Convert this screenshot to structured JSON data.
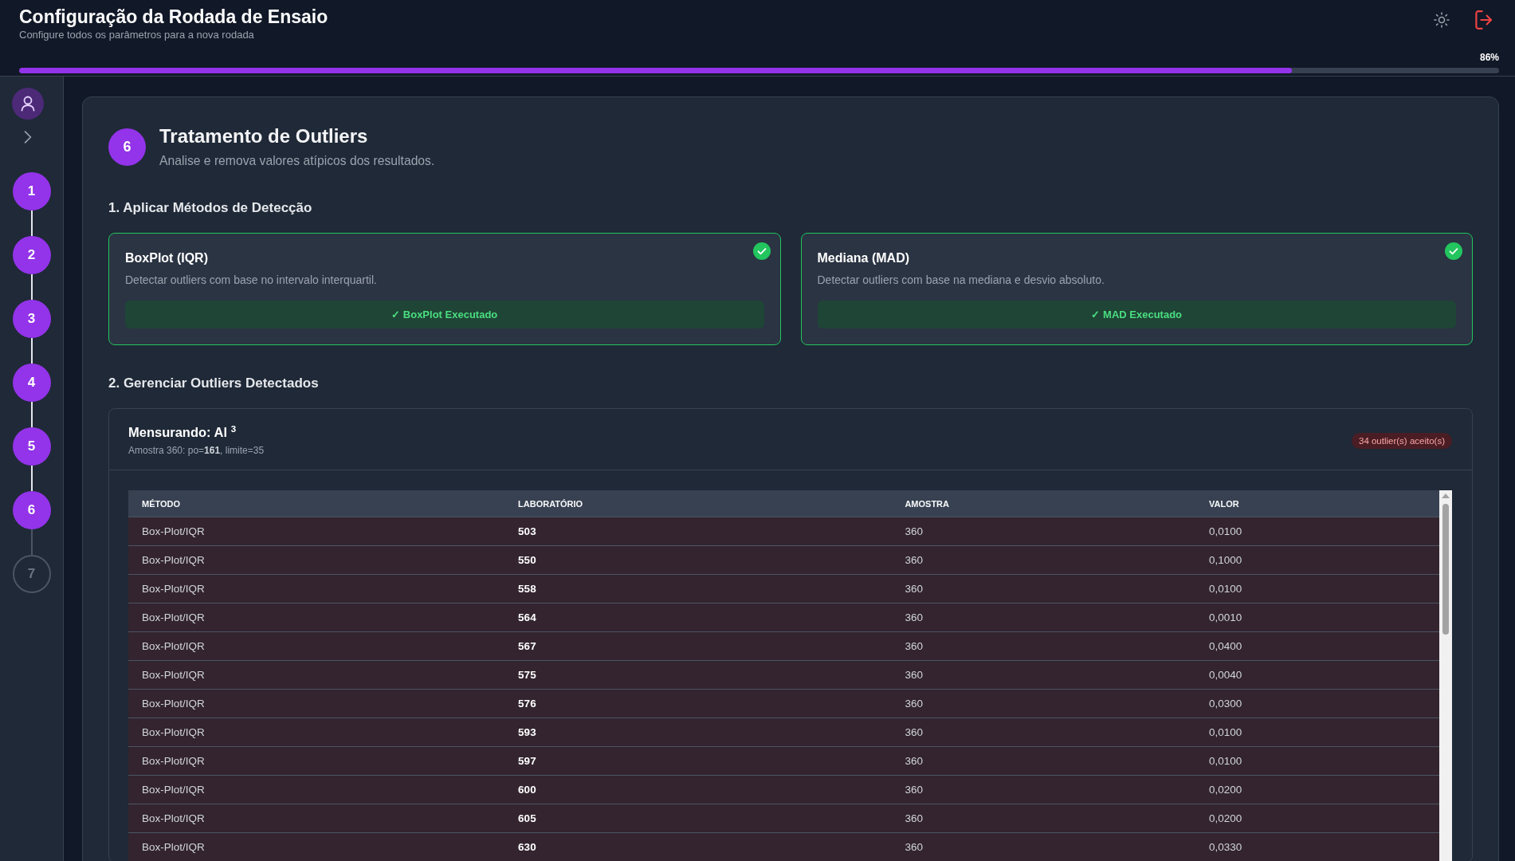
{
  "header": {
    "title": "Configuração da Rodada de Ensaio",
    "subtitle": "Configure todos os parâmetros para a nova rodada",
    "progress": {
      "level": 0.86,
      "reading": "86%"
    }
  },
  "sidebar": {
    "steps": [
      {
        "label": "1",
        "completed": true
      },
      {
        "label": "2",
        "completed": true
      },
      {
        "label": "3",
        "completed": true
      },
      {
        "label": "4",
        "completed": true
      },
      {
        "label": "5",
        "completed": true
      },
      {
        "label": "6",
        "completed": true
      },
      {
        "label": "7",
        "completed": false
      }
    ]
  },
  "step": {
    "number": "6",
    "title": "Tratamento de Outliers",
    "subtitle": "Analise e remova valores atípicos dos resultados."
  },
  "detection": {
    "heading": "1. Aplicar Métodos de Detecção",
    "methods": [
      {
        "title": "BoxPlot (IQR)",
        "description": "Detectar outliers com base no intervalo interquartil.",
        "action": "✓ BoxPlot Executado",
        "executed": true
      },
      {
        "title": "Mediana (MAD)",
        "description": "Detectar outliers com base na mediana e desvio absoluto.",
        "action": "✓ MAD Executado",
        "executed": true
      }
    ]
  },
  "outliers": {
    "heading": "2. Gerenciar Outliers Detectados",
    "measurand": "Mensurando: Al $^{3}$",
    "sample_info": "Amostra 360: po=**161**, limite=35",
    "badge": "34 outlier(s) aceito(s)",
    "table": {
      "columns": [
        "MÉTODO",
        "LABORATÓRIO",
        "AMOSTRA",
        "VALOR"
      ],
      "rows": [
        [
          "Box-Plot/IQR",
          "503",
          "360",
          "0,0100"
        ],
        [
          "Box-Plot/IQR",
          "550",
          "360",
          "0,1000"
        ],
        [
          "Box-Plot/IQR",
          "558",
          "360",
          "0,0100"
        ],
        [
          "Box-Plot/IQR",
          "564",
          "360",
          "0,0010"
        ],
        [
          "Box-Plot/IQR",
          "567",
          "360",
          "0,0400"
        ],
        [
          "Box-Plot/IQR",
          "575",
          "360",
          "0,0040"
        ],
        [
          "Box-Plot/IQR",
          "576",
          "360",
          "0,0300"
        ],
        [
          "Box-Plot/IQR",
          "593",
          "360",
          "0,0100"
        ],
        [
          "Box-Plot/IQR",
          "597",
          "360",
          "0,0100"
        ],
        [
          "Box-Plot/IQR",
          "600",
          "360",
          "0,0200"
        ],
        [
          "Box-Plot/IQR",
          "605",
          "360",
          "0,0200"
        ],
        [
          "Box-Plot/IQR",
          "630",
          "360",
          "0,0330"
        ]
      ]
    }
  }
}
